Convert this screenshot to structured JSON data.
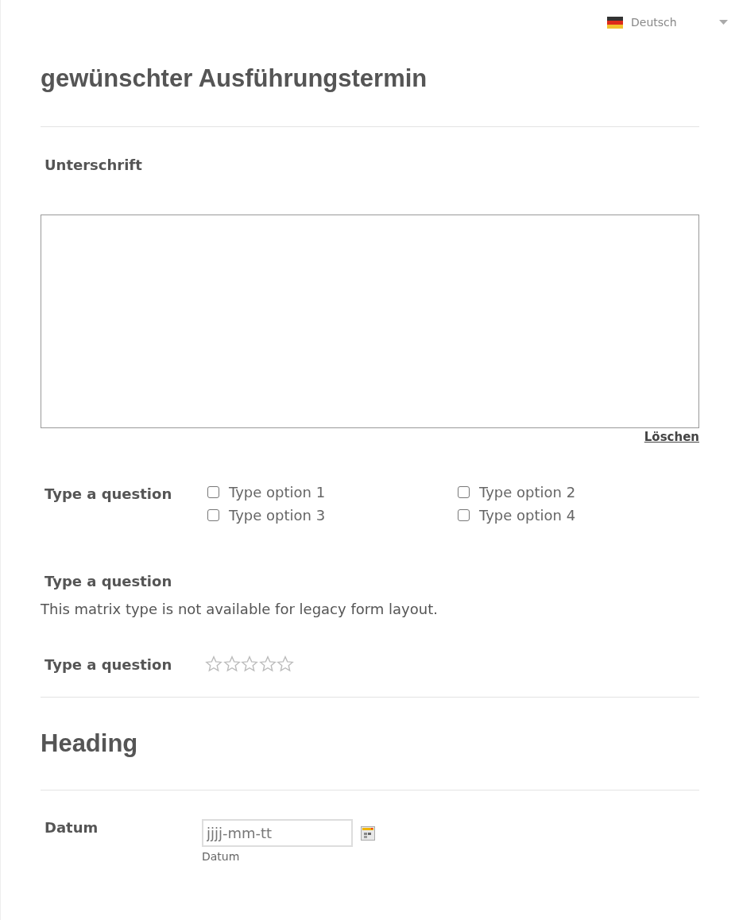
{
  "language": {
    "label": "Deutsch"
  },
  "items": [
    {
      "kind": "heading",
      "text": "gewünschter Ausführungstermin"
    },
    {
      "kind": "divider"
    },
    {
      "kind": "signature",
      "label": "Unterschrift",
      "clear": "Löschen"
    },
    {
      "kind": "checkboxes",
      "label": "Type a question",
      "options": [
        {
          "label": "Type option 1",
          "checked": false
        },
        {
          "label": "Type option 2",
          "checked": false
        },
        {
          "label": "Type option 3",
          "checked": false
        },
        {
          "label": "Type option 4",
          "checked": false
        }
      ]
    },
    {
      "kind": "matrix",
      "label": "Type a question",
      "note": "This matrix type is not available for legacy form layout."
    },
    {
      "kind": "rating",
      "label": "Type a question",
      "stars": 0
    },
    {
      "kind": "divider"
    },
    {
      "kind": "heading",
      "text": "Heading"
    },
    {
      "kind": "divider"
    },
    {
      "kind": "date",
      "label": "Datum",
      "placeholder": "jjjj-mm-tt",
      "sublabel": "Datum"
    }
  ]
}
